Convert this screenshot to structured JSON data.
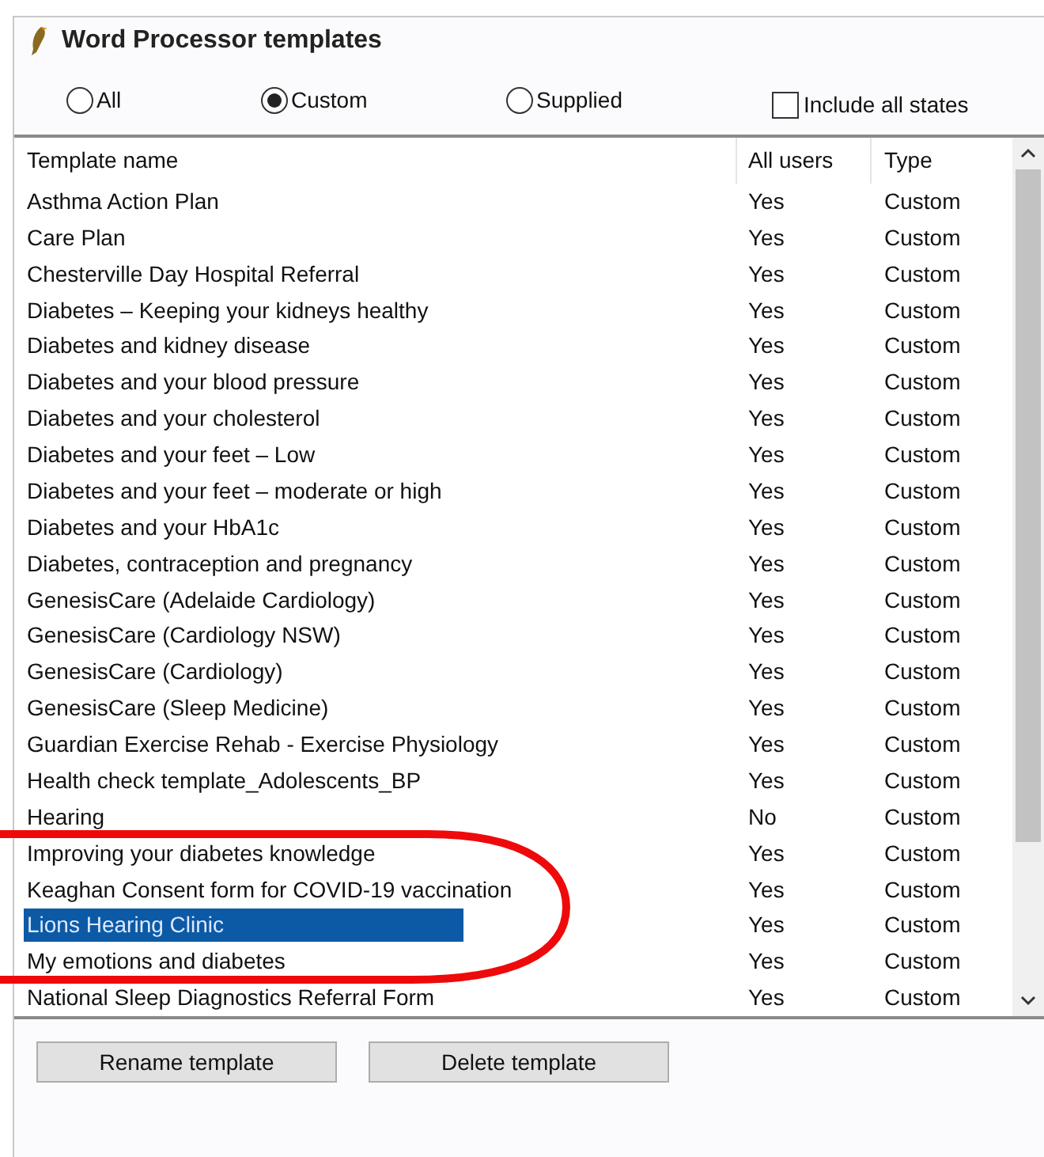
{
  "window": {
    "title": "Word Processor templates"
  },
  "filters": [
    {
      "label": "All",
      "selected": false
    },
    {
      "label": "Custom",
      "selected": true
    },
    {
      "label": "Supplied",
      "selected": false
    }
  ],
  "include_all_states": {
    "label": "Include all states",
    "checked": false
  },
  "table": {
    "columns": [
      "Template name",
      "All users",
      "Type"
    ],
    "rows": [
      {
        "cells": [
          "Asthma Action Plan",
          "Yes",
          "Custom"
        ],
        "selected": false
      },
      {
        "cells": [
          "Care Plan",
          "Yes",
          "Custom"
        ],
        "selected": false
      },
      {
        "cells": [
          "Chesterville Day Hospital Referral",
          "Yes",
          "Custom"
        ],
        "selected": false
      },
      {
        "cells": [
          "Diabetes – Keeping your kidneys healthy",
          "Yes",
          "Custom"
        ],
        "selected": false
      },
      {
        "cells": [
          "Diabetes and kidney disease",
          "Yes",
          "Custom"
        ],
        "selected": false
      },
      {
        "cells": [
          "Diabetes and your blood pressure",
          "Yes",
          "Custom"
        ],
        "selected": false
      },
      {
        "cells": [
          "Diabetes and your cholesterol",
          "Yes",
          "Custom"
        ],
        "selected": false
      },
      {
        "cells": [
          "Diabetes and your feet – Low",
          "Yes",
          "Custom"
        ],
        "selected": false
      },
      {
        "cells": [
          "Diabetes and your feet – moderate or high",
          "Yes",
          "Custom"
        ],
        "selected": false
      },
      {
        "cells": [
          "Diabetes and your HbA1c",
          "Yes",
          "Custom"
        ],
        "selected": false
      },
      {
        "cells": [
          "Diabetes, contraception and pregnancy",
          "Yes",
          "Custom"
        ],
        "selected": false
      },
      {
        "cells": [
          "GenesisCare (Adelaide Cardiology)",
          "Yes",
          "Custom"
        ],
        "selected": false
      },
      {
        "cells": [
          "GenesisCare (Cardiology NSW)",
          "Yes",
          "Custom"
        ],
        "selected": false
      },
      {
        "cells": [
          "GenesisCare (Cardiology)",
          "Yes",
          "Custom"
        ],
        "selected": false
      },
      {
        "cells": [
          "GenesisCare (Sleep Medicine)",
          "Yes",
          "Custom"
        ],
        "selected": false
      },
      {
        "cells": [
          "Guardian Exercise Rehab - Exercise Physiology",
          "Yes",
          "Custom"
        ],
        "selected": false
      },
      {
        "cells": [
          "Health check template_Adolescents_BP",
          "Yes",
          "Custom"
        ],
        "selected": false
      },
      {
        "cells": [
          "Hearing",
          "No",
          "Custom"
        ],
        "selected": false
      },
      {
        "cells": [
          "Improving your diabetes knowledge",
          "Yes",
          "Custom"
        ],
        "selected": false
      },
      {
        "cells": [
          "Keaghan Consent form for COVID-19 vaccination",
          "Yes",
          "Custom"
        ],
        "selected": false
      },
      {
        "cells": [
          "Lions Hearing Clinic",
          "Yes",
          "Custom"
        ],
        "selected": true
      },
      {
        "cells": [
          "My emotions and diabetes",
          "Yes",
          "Custom"
        ],
        "selected": false
      },
      {
        "cells": [
          "National Sleep Diagnostics Referral Form",
          "Yes",
          "Custom"
        ],
        "selected": false
      }
    ]
  },
  "buttons": [
    "Rename template",
    "Delete template"
  ]
}
